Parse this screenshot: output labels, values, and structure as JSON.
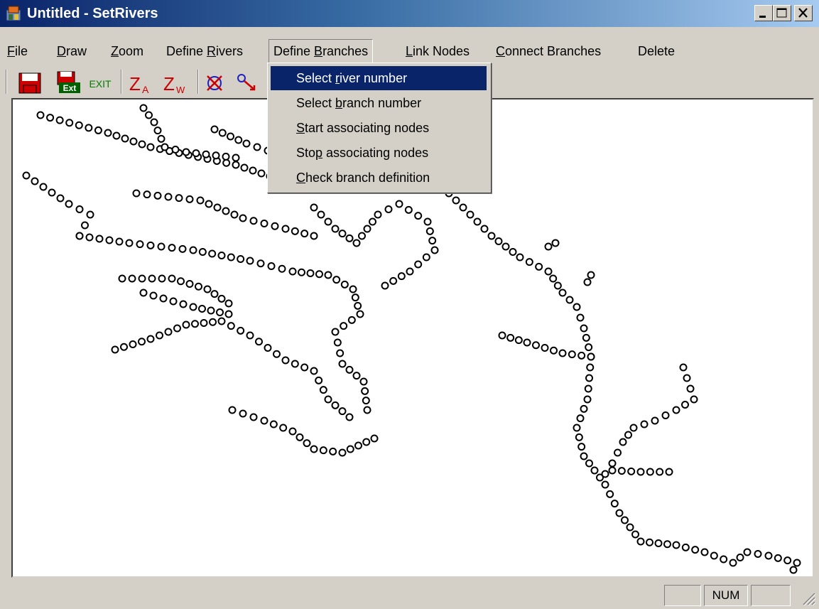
{
  "window": {
    "title": "Untitled - SetRivers",
    "minimize_label": "minimize",
    "maximize_label": "maximize",
    "close_label": "close"
  },
  "menubar": {
    "items": [
      {
        "label": "File",
        "access": "F",
        "rest": "ile"
      },
      {
        "label": "Draw",
        "access": "D",
        "rest": "raw"
      },
      {
        "label": "Zoom",
        "access": "Z",
        "rest": "oom"
      },
      {
        "label": "Define Rivers",
        "pre": "Define ",
        "access": "R",
        "rest": "ivers"
      },
      {
        "label": "Define Branches",
        "pre": "Define ",
        "access": "B",
        "rest": "ranches"
      },
      {
        "label": "Link Nodes",
        "access": "L",
        "rest": "ink Nodes"
      },
      {
        "label": "Connect Branches",
        "access": "C",
        "rest": "onnect Branches"
      },
      {
        "label": "Delete"
      }
    ]
  },
  "toolbar": {
    "buttons": [
      {
        "name": "save-icon"
      },
      {
        "name": "save-exit-icon",
        "text": "Ext"
      },
      {
        "name": "exit-icon",
        "text": "EXIT"
      },
      {
        "name": "zoom-all-icon",
        "text": "Z",
        "sub": "A"
      },
      {
        "name": "zoom-window-icon",
        "text": "Z",
        "sub": "W"
      },
      {
        "name": "delete-node-icon"
      },
      {
        "name": "link-node-icon"
      }
    ]
  },
  "dropdown": {
    "menu": "Define Branches",
    "items": [
      {
        "label": "Select river number",
        "pre": "Select ",
        "access": "r",
        "rest": "iver number",
        "selected": true
      },
      {
        "label": "Select branch number",
        "pre": "Select ",
        "access": "b",
        "rest": "ranch number",
        "selected": false
      },
      {
        "label": "Start associating nodes",
        "pre": "",
        "access": "S",
        "rest": "tart associating nodes",
        "selected": false
      },
      {
        "label": "Stop associating nodes",
        "pre": "Sto",
        "access": "p",
        "rest": " associating nodes",
        "selected": false
      },
      {
        "label": "Check branch definition",
        "pre": "",
        "access": "C",
        "rest": "heck branch definition",
        "selected": false
      }
    ]
  },
  "statusbar": {
    "panes": [
      "",
      "NUM",
      ""
    ]
  },
  "colors": {
    "titlebar_start": "#0a246a",
    "titlebar_end": "#a6caf0",
    "selection": "#0a246a",
    "face": "#d4d0c8",
    "toolbar_red": "#cc0000",
    "toolbar_green": "#008000"
  }
}
